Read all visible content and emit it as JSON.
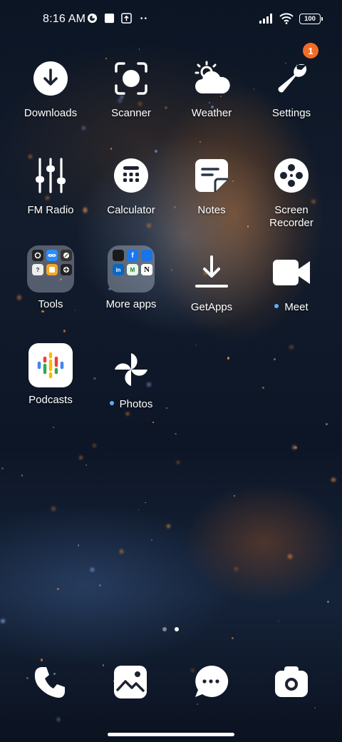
{
  "status_bar": {
    "time": "8:16 AM",
    "left_icons": [
      "messaging-icon",
      "square-notification-icon",
      "upload-icon",
      "more-dots-icon"
    ],
    "right_icons": [
      "signal-icon",
      "wifi-icon",
      "battery-icon"
    ],
    "battery": "100"
  },
  "apps": [
    {
      "label": "Downloads",
      "icon": "download-icon"
    },
    {
      "label": "Scanner",
      "icon": "scanner-icon"
    },
    {
      "label": "Weather",
      "icon": "weather-icon"
    },
    {
      "label": "Settings",
      "icon": "wrench-icon",
      "badge": "1"
    },
    {
      "label": "FM Radio",
      "icon": "equalizer-icon"
    },
    {
      "label": "Calculator",
      "icon": "calculator-icon"
    },
    {
      "label": "Notes",
      "icon": "notes-icon"
    },
    {
      "label": "Screen Recorder",
      "icon": "film-reel-icon"
    },
    {
      "label": "Tools",
      "icon": "folder-icon"
    },
    {
      "label": "More apps",
      "icon": "folder-icon"
    },
    {
      "label": "GetApps",
      "icon": "download-tray-icon"
    },
    {
      "label": "Meet",
      "icon": "video-camera-icon",
      "new_dot": true
    },
    {
      "label": "Podcasts",
      "icon": "podcasts-icon"
    },
    {
      "label": "Photos",
      "icon": "pinwheel-icon",
      "new_dot": true
    }
  ],
  "folder_more_apps_letter": "N",
  "dock": [
    {
      "icon": "phone-icon"
    },
    {
      "icon": "gallery-icon"
    },
    {
      "icon": "chat-bubble-icon"
    },
    {
      "icon": "camera-icon"
    }
  ],
  "page_indicator": {
    "pages": 2,
    "active": 2
  },
  "colors": {
    "badge": "#f26c26",
    "new_dot": "#5ab0ff"
  }
}
